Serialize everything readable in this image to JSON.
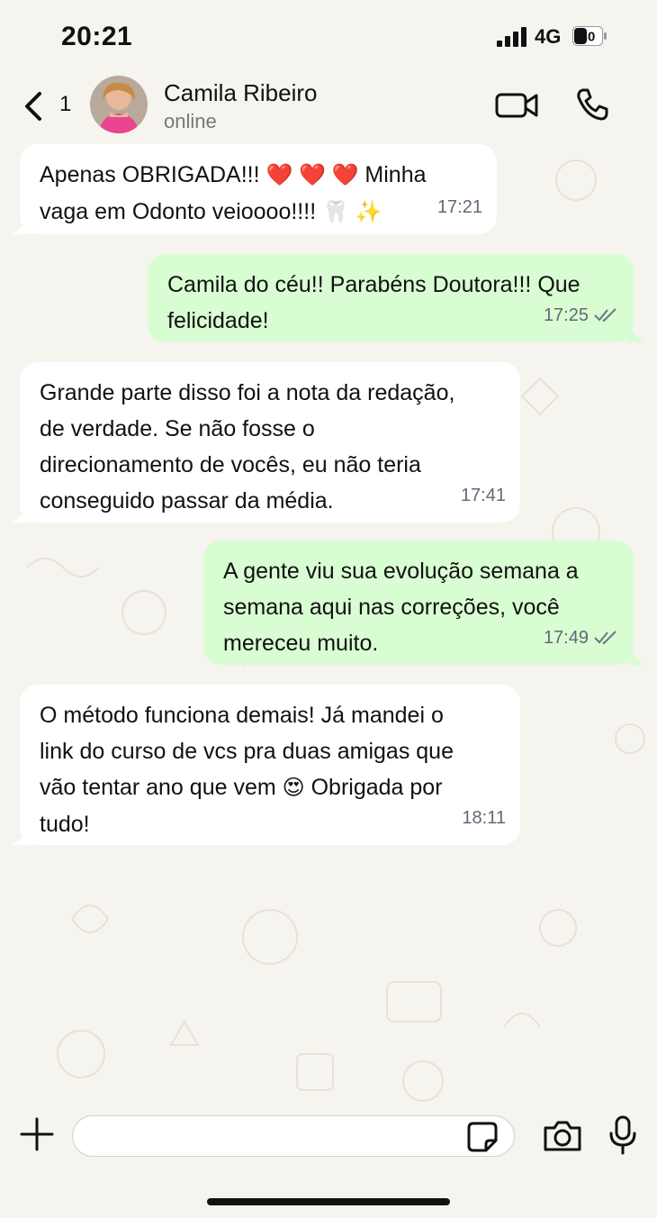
{
  "status_bar": {
    "time": "20:21",
    "network": "4G",
    "battery": "30"
  },
  "header": {
    "back_count": "1",
    "contact_name": "Camila Ribeiro",
    "presence": "online"
  },
  "messages": [
    {
      "direction": "in",
      "parts": [
        "Apenas OBRIGADA!!! ",
        "❤️ ❤️ ❤️",
        " Minha",
        "vaga em Odonto veioooo!!!! ",
        "🦷 ✨"
      ],
      "time": "17:21"
    },
    {
      "direction": "out",
      "lines": [
        "Camila do céu!! Parabéns Doutora!!! Que",
        "felicidade!"
      ],
      "time": "17:25",
      "status": "read"
    },
    {
      "direction": "in",
      "lines": [
        "Grande parte disso foi a nota da redação,",
        "de verdade. Se não fosse o",
        "direcionamento de vocês, eu não teria",
        "conseguido passar da média."
      ],
      "time": "17:41"
    },
    {
      "direction": "out",
      "lines": [
        "A gente viu sua evolução semana a",
        "semana aqui nas correções, você",
        "mereceu muito."
      ],
      "time": "17:49",
      "status": "read"
    },
    {
      "direction": "in",
      "lines": [
        "O método funciona demais! Já mandei o",
        "link do curso de vcs pra duas amigas que",
        "vão tentar ano que vem ",
        " Obrigada por",
        "tudo!"
      ],
      "emoji": "😍",
      "time": "18:11"
    }
  ],
  "input": {
    "placeholder": ""
  },
  "colors": {
    "incoming": "#ffffff",
    "outgoing": "#d9fdd3",
    "background": "#f6f4ef",
    "read_tick": "#667781"
  }
}
